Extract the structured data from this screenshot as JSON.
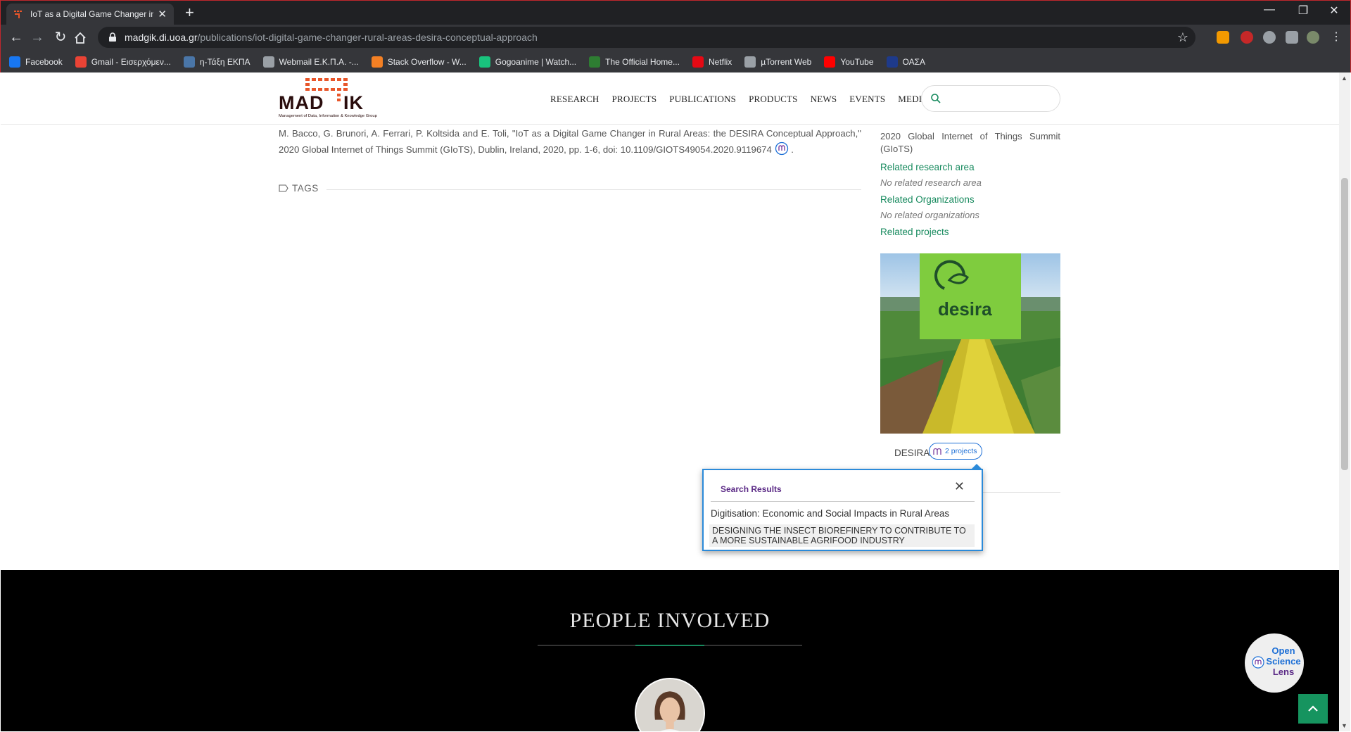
{
  "browser": {
    "tab_title": "IoT as a Digital Game Changer in",
    "tab_close": "✕",
    "new_tab": "+",
    "window_controls": [
      "—",
      "❐",
      "✕"
    ],
    "url_host": "madgik.di.uoa.gr",
    "url_path": "/publications/iot-digital-game-changer-rural-areas-desira-conceptual-approach",
    "bookmarks": [
      {
        "label": "Facebook",
        "color": "#1877f2"
      },
      {
        "label": "Gmail - Εισερχόμεν...",
        "color": "#ea4335"
      },
      {
        "label": "η-Τάξη ΕΚΠΑ",
        "color": "#4a76a8"
      },
      {
        "label": "Webmail Ε.Κ.Π.Α. -...",
        "color": "#9aa0a6"
      },
      {
        "label": "Stack Overflow - W...",
        "color": "#f48024"
      },
      {
        "label": "Gogoanime | Watch...",
        "color": "#19c37d"
      },
      {
        "label": "The Official Home...",
        "color": "#2e7d32"
      },
      {
        "label": "Netflix",
        "color": "#e50914"
      },
      {
        "label": "µTorrent Web",
        "color": "#9aa0a6"
      },
      {
        "label": "YouTube",
        "color": "#ff0000"
      },
      {
        "label": "ΟΑΣΑ",
        "color": "#1e3a8a"
      }
    ]
  },
  "site": {
    "logo_text": "MAD IK",
    "logo_tagline": "Management of Data, Information & Knowledge Group",
    "nav": [
      "RESEARCH",
      "PROJECTS",
      "PUBLICATIONS",
      "PRODUCTS",
      "NEWS",
      "EVENTS",
      "MEDIA"
    ],
    "search_placeholder": ""
  },
  "publication": {
    "citation": "M. Bacco, G. Brunori, A. Ferrari, P. Koltsida and E. Toli, \"IoT as a Digital Game Changer in Rural Areas: the DESIRA Conceptual Approach,\" 2020 Global Internet of Things Summit (GIoTS), Dublin, Ireland, 2020, pp. 1-6, doi: 10.1109/GIOTS49054.2020.9119674",
    "citation_end": ".",
    "tags_label": "TAGS"
  },
  "sidebar": {
    "venue": "2020 Global Internet of Things Summit (GIoTS)",
    "related_research_heading": "Related research area",
    "related_research_value": "No related research area",
    "related_orgs_heading": "Related Organizations",
    "related_orgs_value": "No related organizations",
    "related_projects_heading": "Related projects",
    "project_logo_text": "desira",
    "project_name": "DESIRA",
    "project_badge": "2 projects"
  },
  "popup": {
    "title": "Search Results",
    "close": "✕",
    "results": [
      "Digitisation: Economic and Social Impacts in Rural Areas",
      "DESIGNING THE INSECT BIOREFINERY TO CONTRIBUTE TO A MORE SUSTAINABLE AGRIFOOD INDUSTRY"
    ]
  },
  "people": {
    "title": "PEOPLE INVOLVED"
  },
  "widgets": {
    "osl_line1": "Open",
    "osl_line2": "Science",
    "osl_line3": "Lens"
  },
  "colors": {
    "accent_green": "#178a5e",
    "badge_blue": "#1d6fd6",
    "popup_purple": "#5b2a86",
    "logo_orange": "#e8562a"
  }
}
